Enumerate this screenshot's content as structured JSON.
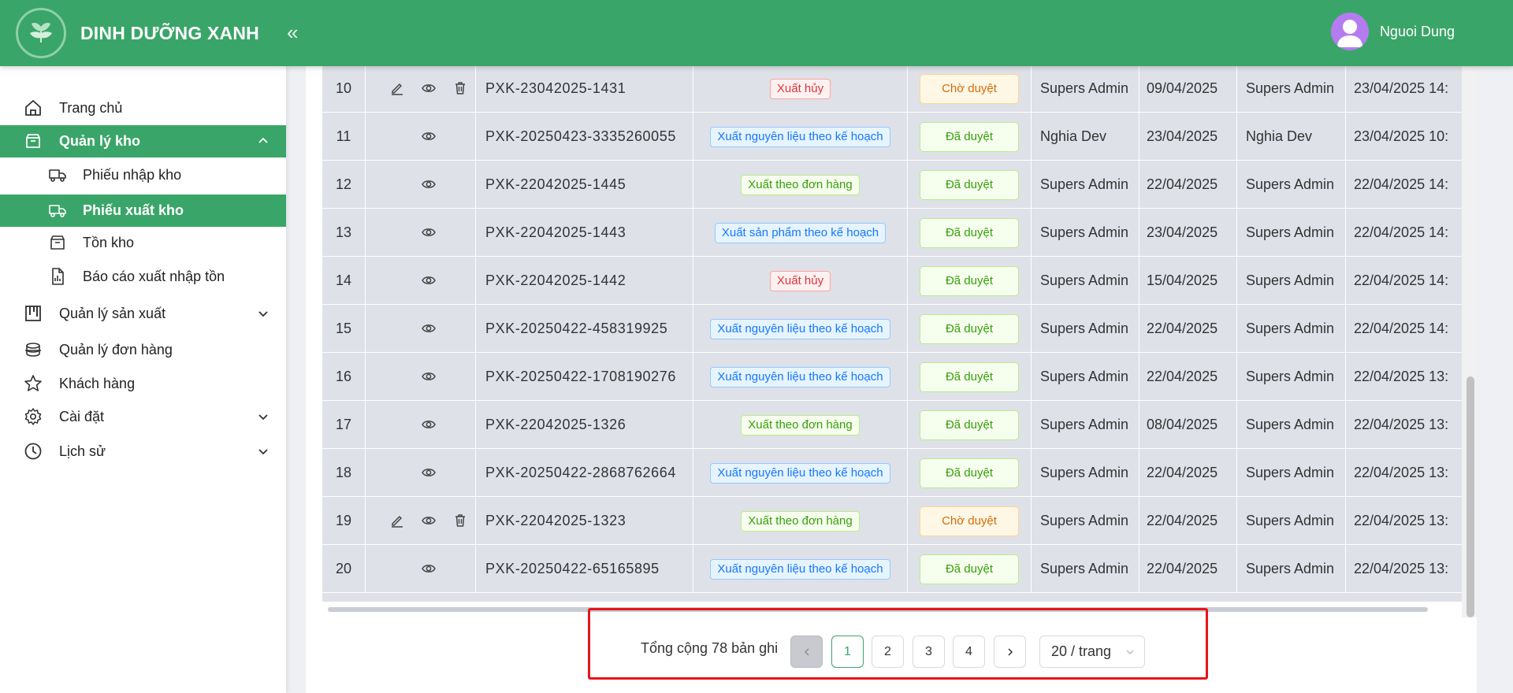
{
  "brand": {
    "name": "DINH DƯỠNG XANH"
  },
  "header": {
    "collapse_label": "«",
    "user_name": "Nguoi Dung"
  },
  "sidebar": {
    "items": [
      {
        "label": "Trang chủ"
      },
      {
        "label": "Quản lý kho"
      },
      {
        "label": "Phiếu nhập kho"
      },
      {
        "label": "Phiếu xuất kho"
      },
      {
        "label": "Tồn kho"
      },
      {
        "label": "Báo cáo xuất nhập tồn"
      },
      {
        "label": "Quản lý sản xuất"
      },
      {
        "label": "Quản lý đơn hàng"
      },
      {
        "label": "Khách hàng"
      },
      {
        "label": "Cài đặt"
      },
      {
        "label": "Lịch sử"
      }
    ]
  },
  "table": {
    "rows": [
      {
        "idx": "10",
        "code": "PXK-23042025-1431",
        "type": "Xuất hủy",
        "type_color": "red",
        "status": "Chờ duyệt",
        "status_kind": "pending",
        "creator": "Supers Admin",
        "date": "09/04/2025",
        "approver": "Supers Admin",
        "approved_at": "23/04/2025 14:",
        "editable": true
      },
      {
        "idx": "11",
        "code": "PXK-20250423-3335260055",
        "type": "Xuất nguyên liệu theo kế hoạch",
        "type_color": "blue",
        "status": "Đã duyệt",
        "status_kind": "approved",
        "creator": "Nghia Dev",
        "date": "23/04/2025",
        "approver": "Nghia Dev",
        "approved_at": "23/04/2025 10:",
        "editable": false
      },
      {
        "idx": "12",
        "code": "PXK-22042025-1445",
        "type": "Xuất theo đơn hàng",
        "type_color": "green",
        "status": "Đã duyệt",
        "status_kind": "approved",
        "creator": "Supers Admin",
        "date": "22/04/2025",
        "approver": "Supers Admin",
        "approved_at": "22/04/2025 14:",
        "editable": false
      },
      {
        "idx": "13",
        "code": "PXK-22042025-1443",
        "type": "Xuất sản phẩm theo kế hoạch",
        "type_color": "blue",
        "status": "Đã duyệt",
        "status_kind": "approved",
        "creator": "Supers Admin",
        "date": "23/04/2025",
        "approver": "Supers Admin",
        "approved_at": "22/04/2025 14:",
        "editable": false
      },
      {
        "idx": "14",
        "code": "PXK-22042025-1442",
        "type": "Xuất hủy",
        "type_color": "red",
        "status": "Đã duyệt",
        "status_kind": "approved",
        "creator": "Supers Admin",
        "date": "15/04/2025",
        "approver": "Supers Admin",
        "approved_at": "22/04/2025 14:",
        "editable": false
      },
      {
        "idx": "15",
        "code": "PXK-20250422-458319925",
        "type": "Xuất nguyên liệu theo kế hoạch",
        "type_color": "blue",
        "status": "Đã duyệt",
        "status_kind": "approved",
        "creator": "Supers Admin",
        "date": "22/04/2025",
        "approver": "Supers Admin",
        "approved_at": "22/04/2025 14:",
        "editable": false
      },
      {
        "idx": "16",
        "code": "PXK-20250422-1708190276",
        "type": "Xuất nguyên liệu theo kế hoạch",
        "type_color": "blue",
        "status": "Đã duyệt",
        "status_kind": "approved",
        "creator": "Supers Admin",
        "date": "22/04/2025",
        "approver": "Supers Admin",
        "approved_at": "22/04/2025 13:",
        "editable": false
      },
      {
        "idx": "17",
        "code": "PXK-22042025-1326",
        "type": "Xuất theo đơn hàng",
        "type_color": "green",
        "status": "Đã duyệt",
        "status_kind": "approved",
        "creator": "Supers Admin",
        "date": "08/04/2025",
        "approver": "Supers Admin",
        "approved_at": "22/04/2025 13:",
        "editable": false
      },
      {
        "idx": "18",
        "code": "PXK-20250422-2868762664",
        "type": "Xuất nguyên liệu theo kế hoạch",
        "type_color": "blue",
        "status": "Đã duyệt",
        "status_kind": "approved",
        "creator": "Supers Admin",
        "date": "22/04/2025",
        "approver": "Supers Admin",
        "approved_at": "22/04/2025 13:",
        "editable": false
      },
      {
        "idx": "19",
        "code": "PXK-22042025-1323",
        "type": "Xuất theo đơn hàng",
        "type_color": "green",
        "status": "Chờ duyệt",
        "status_kind": "pending",
        "creator": "Supers Admin",
        "date": "22/04/2025",
        "approver": "Supers Admin",
        "approved_at": "22/04/2025 13:",
        "editable": true
      },
      {
        "idx": "20",
        "code": "PXK-20250422-65165895",
        "type": "Xuất nguyên liệu theo kế hoạch",
        "type_color": "blue",
        "status": "Đã duyệt",
        "status_kind": "approved",
        "creator": "Supers Admin",
        "date": "22/04/2025",
        "approver": "Supers Admin",
        "approved_at": "22/04/2025 13:",
        "editable": false
      }
    ]
  },
  "pagination": {
    "total_label": "Tổng cộng 78 bản ghi",
    "prev_label": "<",
    "next_label": ">",
    "pages": [
      "1",
      "2",
      "3",
      "4"
    ],
    "current_page": "1",
    "page_size_label": "20 / trang"
  }
}
